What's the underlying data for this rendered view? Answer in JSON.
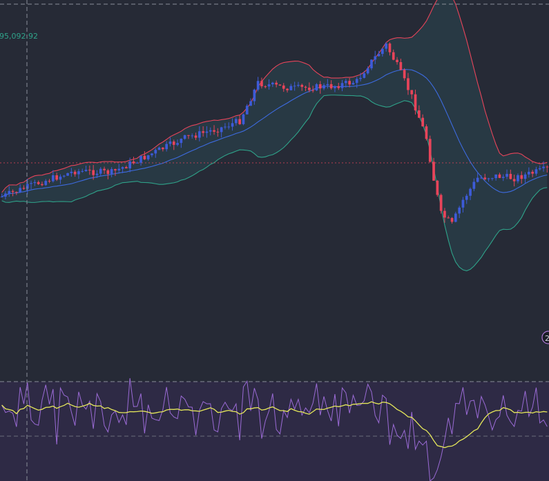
{
  "colors": {
    "background": "#262a36",
    "up_candle": "#3d5bd8",
    "down_candle": "#e8445a",
    "bb_upper": "#e8445a",
    "bb_basis": "#3d6be0",
    "bb_lower": "#2fa38a",
    "bb_fill": "#2a4550",
    "rsi_line": "#9b6bd6",
    "rsi_ma": "#e6e85a",
    "rsi_band": "#2e2a45",
    "price_line": "#e8445a",
    "text_price": "#2fa38a"
  },
  "price_label": "95,092.92",
  "alert_badge": "2",
  "chart_data": [
    {
      "type": "candlestick",
      "panel": "price",
      "overlays": [
        "bollinger-upper",
        "bollinger-basis",
        "bollinger-lower"
      ],
      "candle_count": 150,
      "trend_description_points": {
        "x": [
          0,
          10,
          20,
          30,
          40,
          50,
          60,
          65,
          70,
          75,
          80,
          90,
          97,
          100,
          105,
          108,
          112,
          116,
          118,
          120,
          123,
          126,
          130,
          135,
          140,
          149
        ],
        "close": [
          285,
          265,
          248,
          250,
          225,
          200,
          185,
          175,
          120,
          125,
          128,
          125,
          118,
          95,
          65,
          95,
          140,
          200,
          260,
          310,
          325,
          290,
          258,
          255,
          258,
          245
        ]
      }
    },
    {
      "type": "line",
      "panel": "rsi",
      "series": [
        {
          "values_desc": "oscillator"
        },
        {
          "values_desc": "smoothed"
        }
      ]
    }
  ]
}
